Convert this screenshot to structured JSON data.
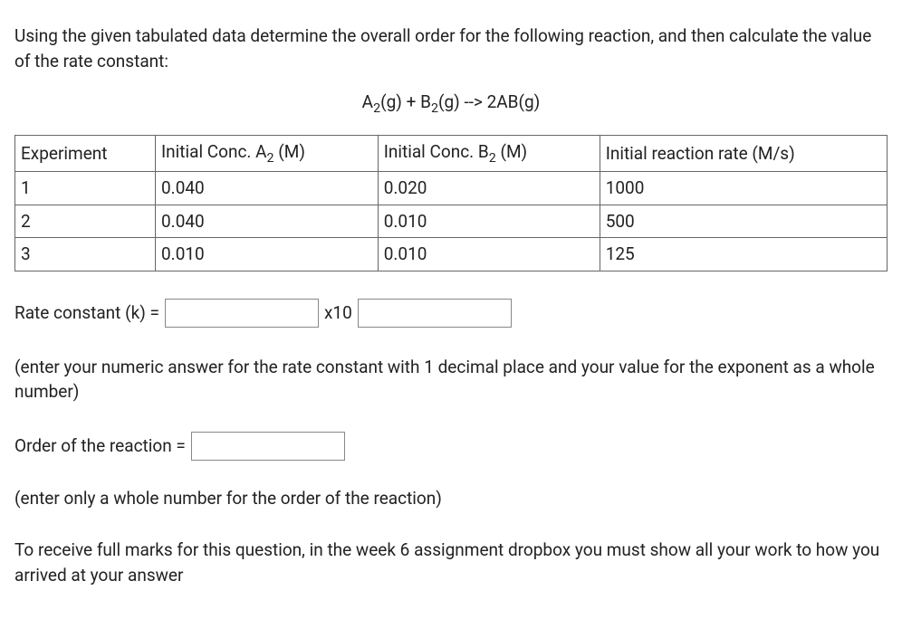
{
  "intro": "Using the given tabulated data determine the overall order for the following reaction, and then calculate the value of the rate constant:",
  "equation_html": "A<sub>2</sub>(g) + B<sub>2</sub>(g) --> 2AB(g)",
  "table": {
    "headers": {
      "c0": "Experiment",
      "c1_html": "Initial Conc. A<sub>2</sub> (M)",
      "c2_html": "Initial Conc. B<sub>2</sub> (M)",
      "c3": "Initial reaction rate (M/s)"
    },
    "rows": [
      {
        "c0": "1",
        "c1": "0.040",
        "c2": "0.020",
        "c3": "1000"
      },
      {
        "c0": "2",
        "c1": "0.040",
        "c2": "0.010",
        "c3": "500"
      },
      {
        "c0": "3",
        "c1": "0.010",
        "c2": "0.010",
        "c3": "125"
      }
    ]
  },
  "rate_label": "Rate constant (k) =",
  "x10": "x10",
  "hint1": "(enter your numeric answer for the rate constant with 1 decimal place and your value for the exponent as a whole number)",
  "order_label": "Order of the reaction =",
  "hint2": "(enter only a whole number for the order of the reaction)",
  "final": "To receive full marks for this question, in the week 6 assignment dropbox you must show all your work to how you arrived at your answer"
}
